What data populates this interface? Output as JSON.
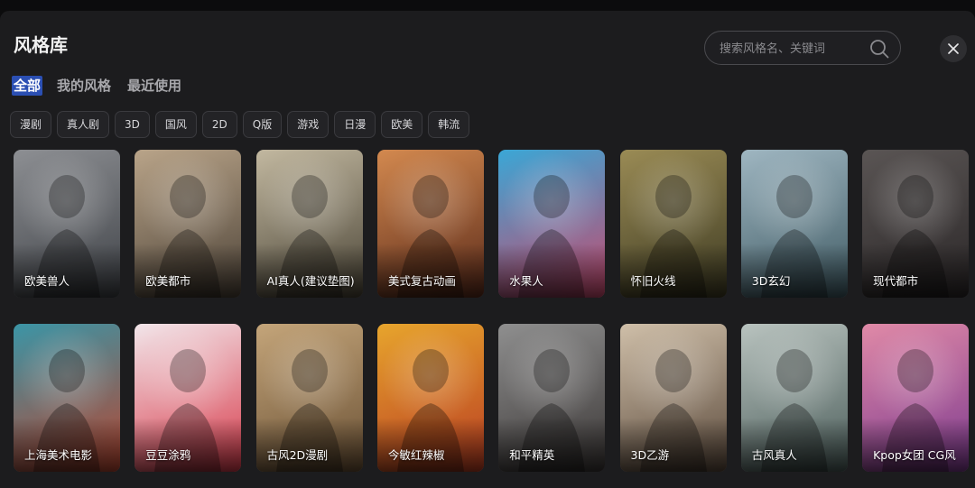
{
  "dialog": {
    "title": "风格库",
    "search_placeholder": "搜索风格名、关键词",
    "close_icon": "close-icon",
    "search_icon": "search-icon"
  },
  "tabs": [
    {
      "label": "全部",
      "active": true
    },
    {
      "label": "我的风格",
      "active": false
    },
    {
      "label": "最近使用",
      "active": false
    }
  ],
  "filters": [
    "漫剧",
    "真人剧",
    "3D",
    "国风",
    "2D",
    "Q版",
    "游戏",
    "日漫",
    "欧美",
    "韩流"
  ],
  "cards": [
    {
      "label": "欧美兽人",
      "colors": [
        "#8d8f93",
        "#3e4146"
      ]
    },
    {
      "label": "欧美都市",
      "colors": [
        "#b9a489",
        "#4c4237"
      ]
    },
    {
      "label": "AI真人(建议垫图)",
      "colors": [
        "#c2b8a0",
        "#4a4436"
      ]
    },
    {
      "label": "美式复古动画",
      "colors": [
        "#d3894f",
        "#5a2a1a"
      ]
    },
    {
      "label": "水果人",
      "colors": [
        "#3aa7d6",
        "#c9476b"
      ]
    },
    {
      "label": "怀旧火线",
      "colors": [
        "#9a8b55",
        "#3d3a22"
      ]
    },
    {
      "label": "3D玄幻",
      "colors": [
        "#9fb6c1",
        "#3f5a63"
      ]
    },
    {
      "label": "现代都市",
      "colors": [
        "#5a5554",
        "#2a2627"
      ]
    },
    {
      "label": "上海美术电影",
      "colors": [
        "#3b95a6",
        "#b8452f"
      ]
    },
    {
      "label": "豆豆涂鸦",
      "colors": [
        "#f2e6ea",
        "#d83a4a"
      ]
    },
    {
      "label": "古风2D漫剧",
      "colors": [
        "#c4a57a",
        "#6a5135"
      ]
    },
    {
      "label": "今敏红辣椒",
      "colors": [
        "#e7a52d",
        "#b93c22"
      ]
    },
    {
      "label": "和平精英",
      "colors": [
        "#8f8f8f",
        "#3a3635"
      ]
    },
    {
      "label": "3D乙游",
      "colors": [
        "#cfbfa9",
        "#5b4a3c"
      ]
    },
    {
      "label": "古风真人",
      "colors": [
        "#b9c3bf",
        "#4b5d5a"
      ]
    },
    {
      "label": "Kpop女团 CG风",
      "colors": [
        "#e08aa7",
        "#7d3a8f"
      ]
    }
  ]
}
